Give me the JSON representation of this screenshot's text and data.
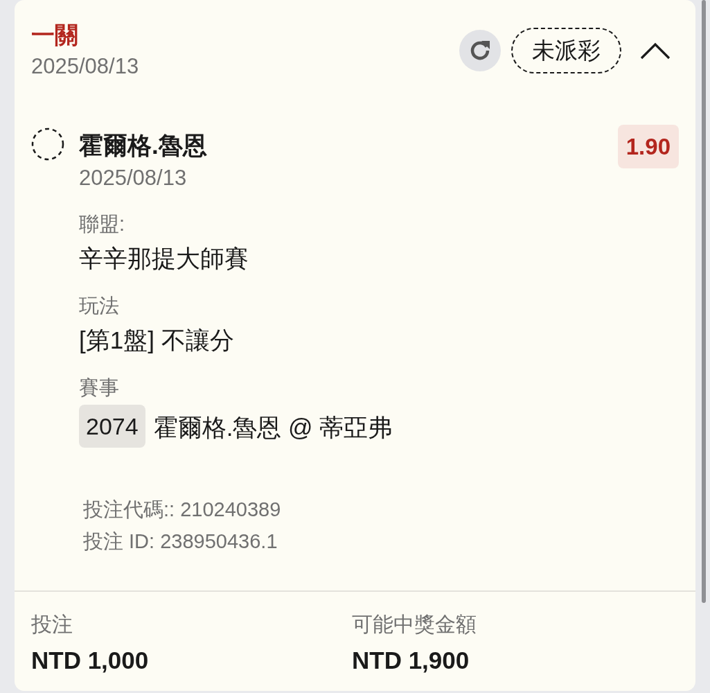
{
  "bet": {
    "title": "一關",
    "date": "2025/08/13",
    "status": {
      "label": "未派彩",
      "kind": "pending"
    },
    "expanded": true
  },
  "selection": {
    "kind": "pending",
    "name": "霍爾格.魯恩",
    "date": "2025/08/13",
    "odds": "1.90",
    "details": [
      {
        "label": "聯盟:",
        "value": "辛辛那提大師賽"
      },
      {
        "label": "玩法",
        "value": "[第1盤] 不讓分"
      },
      {
        "label": "賽事",
        "code": "2074",
        "value": "霍爾格.魯恩 @ 蒂亞弗"
      }
    ]
  },
  "references": [
    "投注代碼:: 210240389",
    "投注 ID: 238950436.1"
  ],
  "totals": [
    {
      "label": "投注",
      "value": "NTD 1,000"
    },
    {
      "label": "可能中獎金額",
      "value": "NTD 1,900"
    }
  ]
}
